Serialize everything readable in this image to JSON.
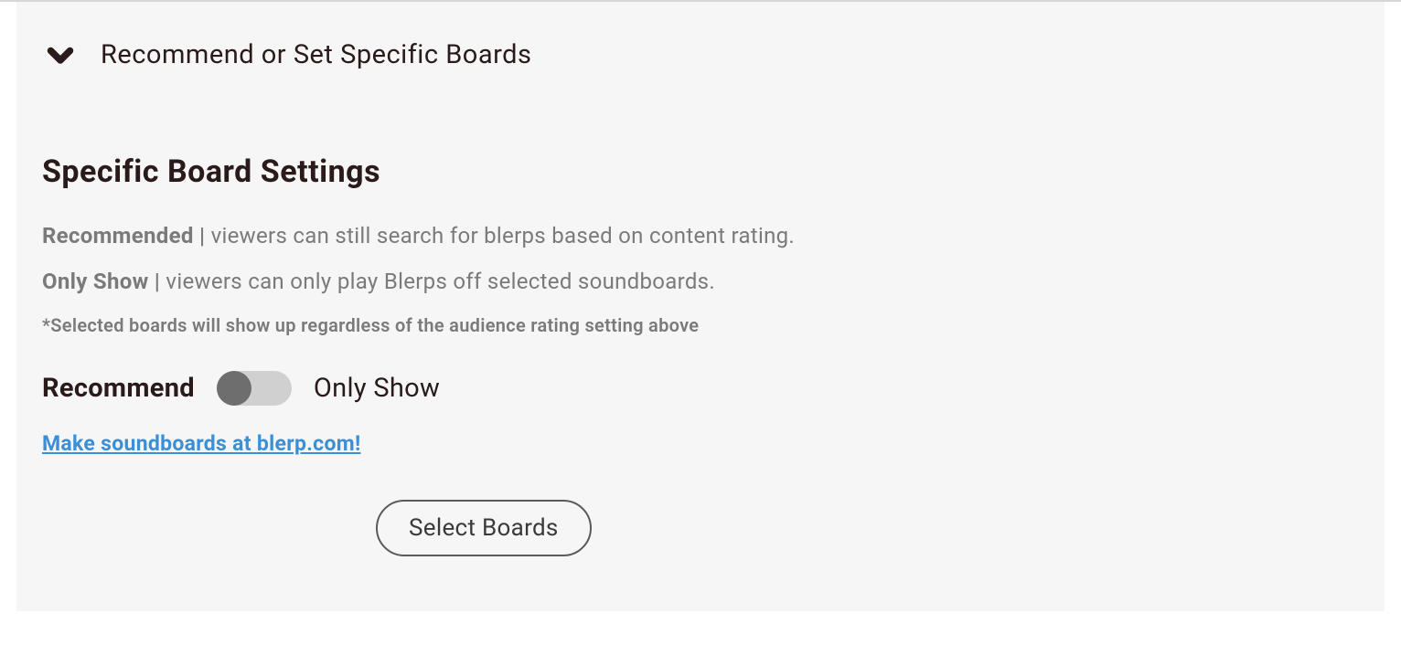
{
  "header": {
    "title": "Recommend or Set Specific Boards"
  },
  "section": {
    "title": "Specific Board Settings",
    "recommended_label": "Recommended",
    "recommended_desc": "viewers can still search for blerps based on content rating.",
    "onlyshow_label": "Only Show",
    "onlyshow_desc": "viewers can only play Blerps off selected soundboards.",
    "note": "*Selected boards will show up regardless of the audience rating setting above"
  },
  "toggle": {
    "left_label": "Recommend",
    "right_label": "Only Show",
    "state": "recommend"
  },
  "link": {
    "text": "Make soundboards at blerp.com!"
  },
  "button": {
    "label": "Select Boards"
  }
}
